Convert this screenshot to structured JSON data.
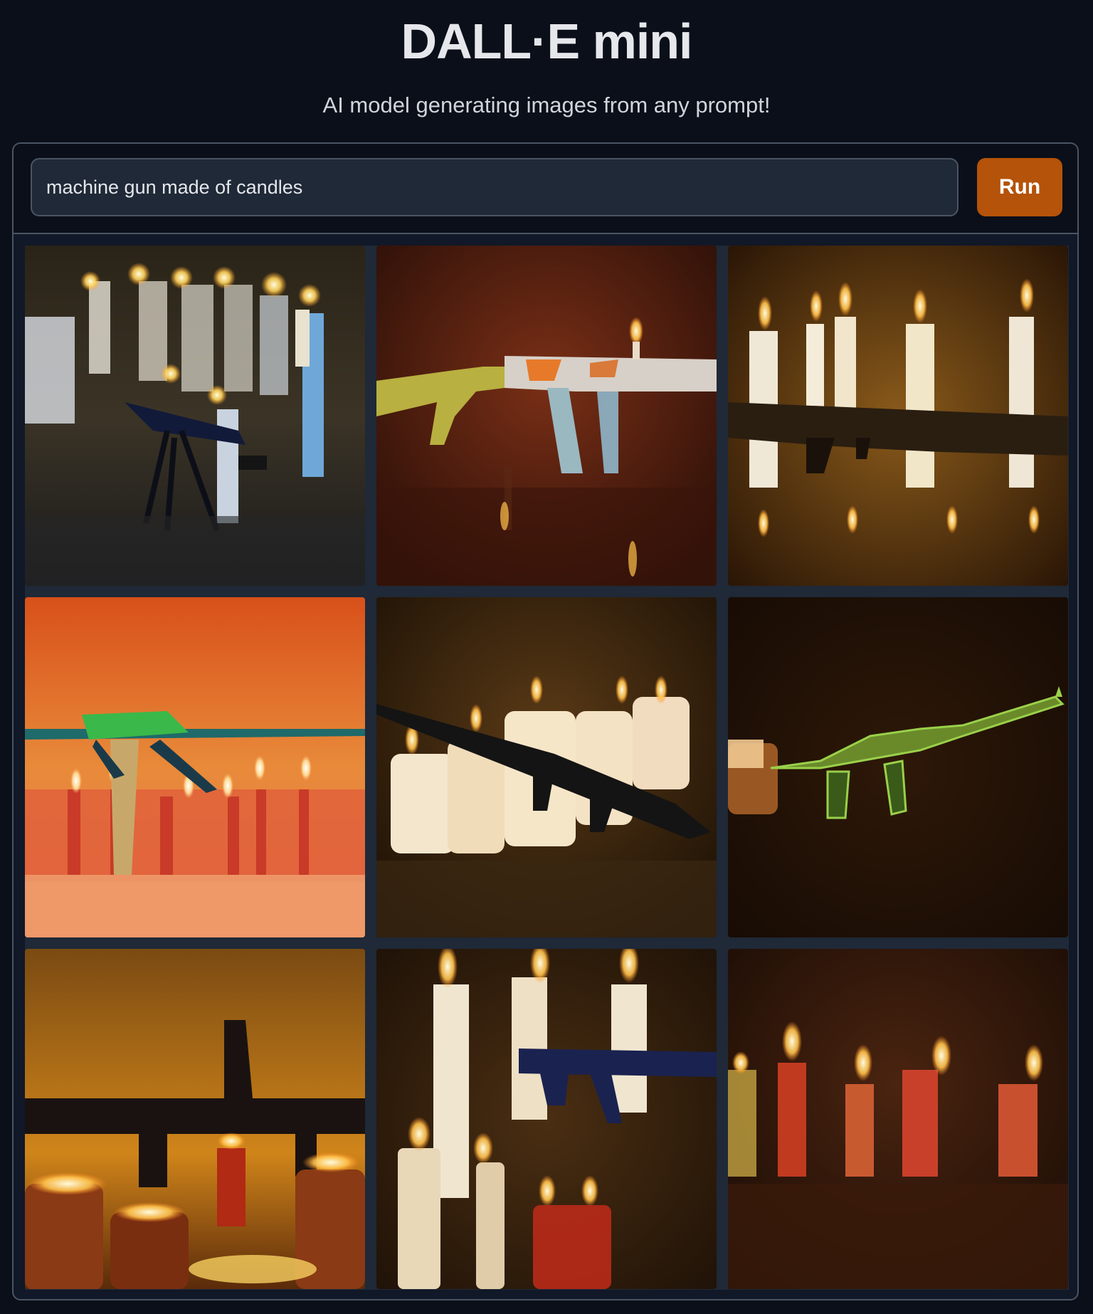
{
  "app": {
    "title": "DALL·E mini",
    "subtitle": "AI model generating images from any prompt!"
  },
  "prompt": {
    "value": "machine gun made of candles"
  },
  "run_button": {
    "label": "Run",
    "color": "#b45309"
  },
  "colors": {
    "background": "#0b0f19",
    "panel_border": "#4b5563",
    "input_background": "#1f2937"
  },
  "gallery": {
    "count": 9,
    "images": [
      {
        "name": "generated-image-1"
      },
      {
        "name": "generated-image-2"
      },
      {
        "name": "generated-image-3"
      },
      {
        "name": "generated-image-4"
      },
      {
        "name": "generated-image-5"
      },
      {
        "name": "generated-image-6"
      },
      {
        "name": "generated-image-7"
      },
      {
        "name": "generated-image-8"
      },
      {
        "name": "generated-image-9"
      }
    ]
  }
}
